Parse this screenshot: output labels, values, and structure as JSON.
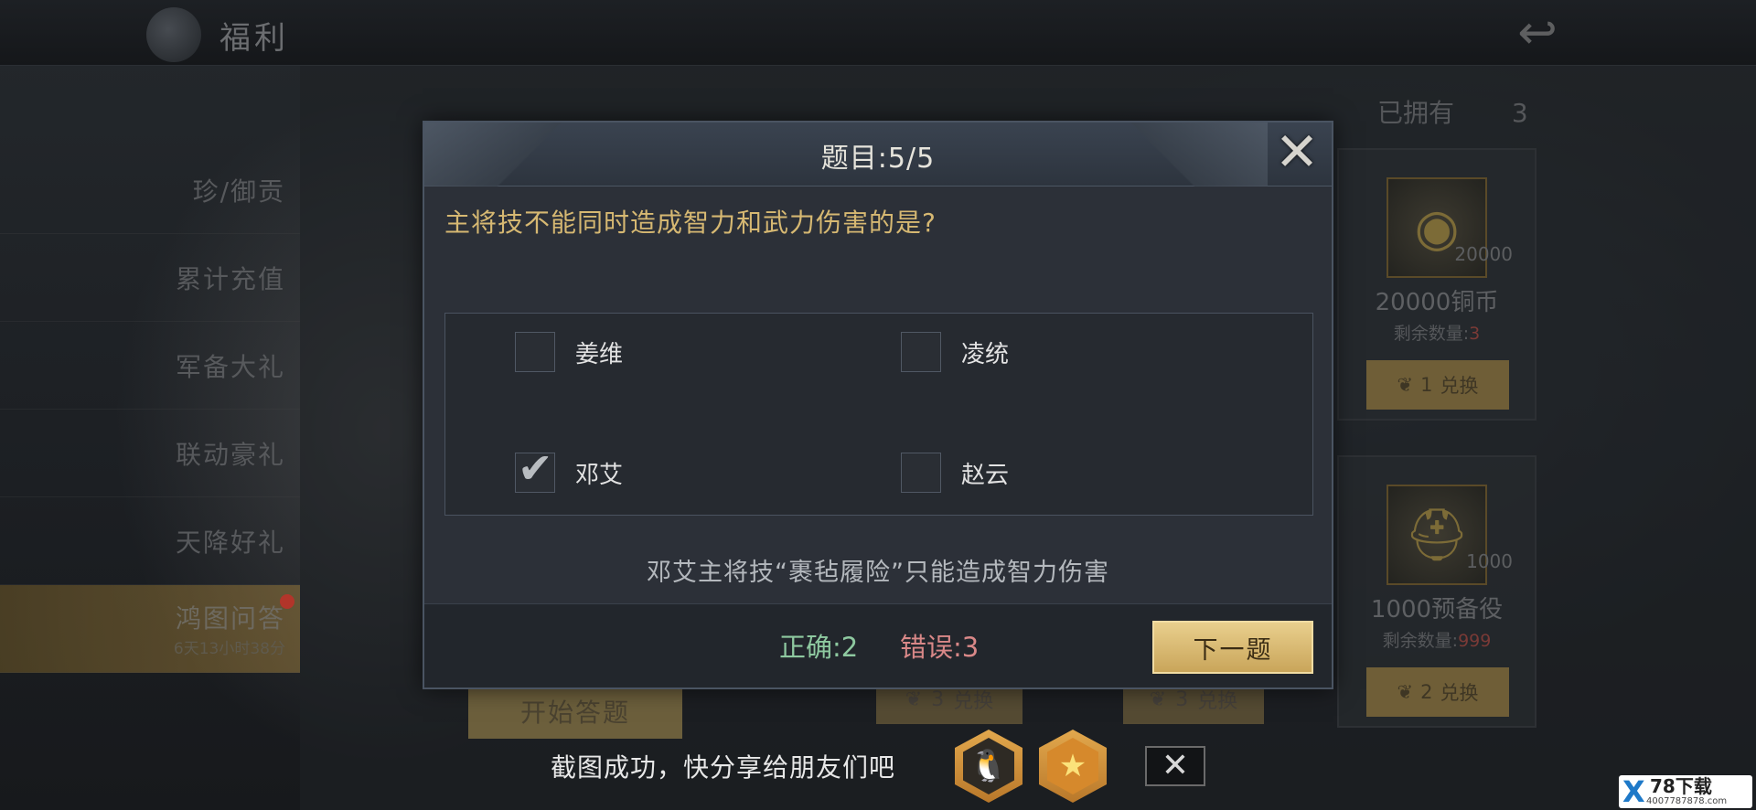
{
  "topbar": {
    "title": "福利"
  },
  "menu": {
    "items": [
      {
        "label": "珍/御贡"
      },
      {
        "label": "累计充值"
      },
      {
        "label": "军备大礼"
      },
      {
        "label": "联动豪礼"
      },
      {
        "label": "天降好礼"
      }
    ],
    "active": {
      "label": "鸿图问答",
      "sub": "6天13小时38分"
    }
  },
  "owned": {
    "label": "已拥有",
    "count": "3"
  },
  "rewards": [
    {
      "qty": "20000",
      "name": "20000铜币",
      "left_label": "剩余数量:",
      "left_value": "3",
      "cost": "1",
      "exchange": "兑换"
    },
    {
      "qty": "1000",
      "name": "1000预备役",
      "left_label": "剩余数量:",
      "left_value": "999",
      "cost": "2",
      "exchange": "兑换"
    }
  ],
  "background_buttons": {
    "start": "开始答题",
    "cost_a": "3",
    "cost_b": "3",
    "exchange": "兑换"
  },
  "quiz": {
    "title": "题目:5/5",
    "question": "主将技不能同时造成智力和武力伤害的是?",
    "options": [
      {
        "label": "姜维",
        "checked": false
      },
      {
        "label": "凌统",
        "checked": false
      },
      {
        "label": "邓艾",
        "checked": true
      },
      {
        "label": "赵云",
        "checked": false
      }
    ],
    "explanation": "邓艾主将技“裹毡履险”只能造成智力伤害",
    "correct": "正确:2",
    "wrong": "错误:3",
    "next_label": "下一题"
  },
  "share": {
    "text": "截图成功，快分享给朋友们吧"
  },
  "watermark": {
    "main": "78下载",
    "sub": "4007787878.com"
  }
}
